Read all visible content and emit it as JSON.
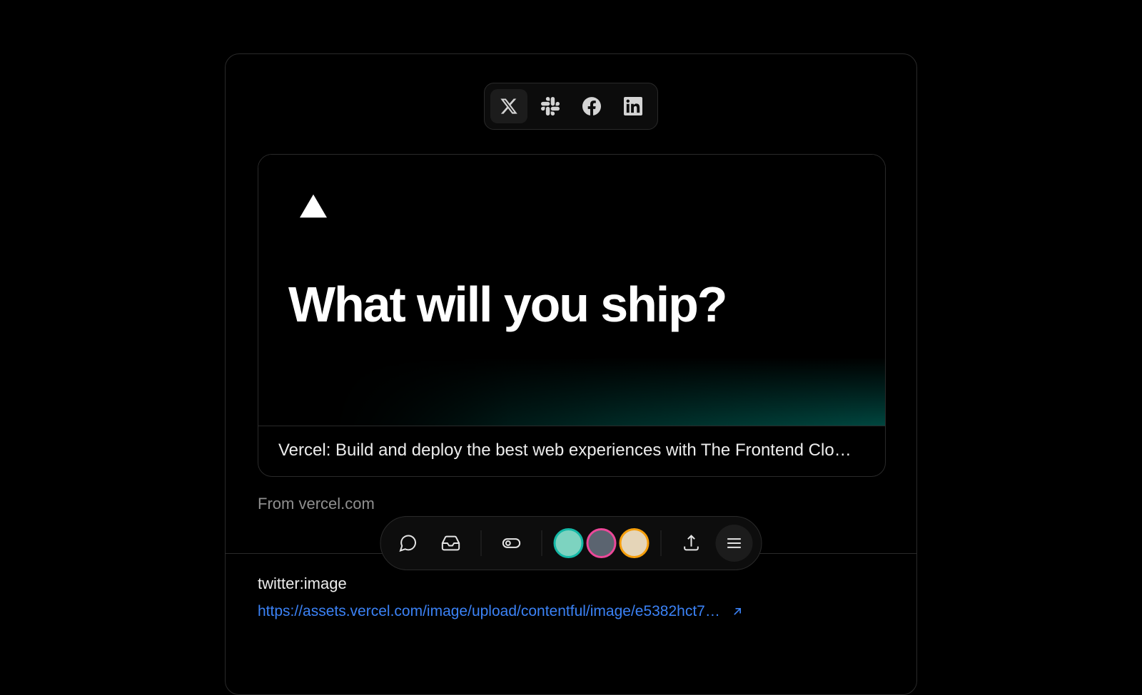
{
  "social": {
    "options": [
      "x",
      "slack",
      "facebook",
      "linkedin"
    ],
    "active": "x"
  },
  "card": {
    "hero_title": "What will you ship?",
    "caption": "Vercel: Build and deploy the best web experiences with The Frontend Clo…",
    "from_prefix": "From ",
    "from_domain": "vercel.com"
  },
  "property": {
    "label": "twitter:image",
    "url_display": "https://assets.vercel.com/image/upload/contentful/image/e5382hct7…"
  },
  "toolbar": {
    "avatars": [
      {
        "ring": "#14b8a6",
        "bg": "#7dd3c0"
      },
      {
        "ring": "#ec4899",
        "bg": "#6b7280"
      },
      {
        "ring": "#f59e0b",
        "bg": "#e5d5b8"
      }
    ]
  }
}
